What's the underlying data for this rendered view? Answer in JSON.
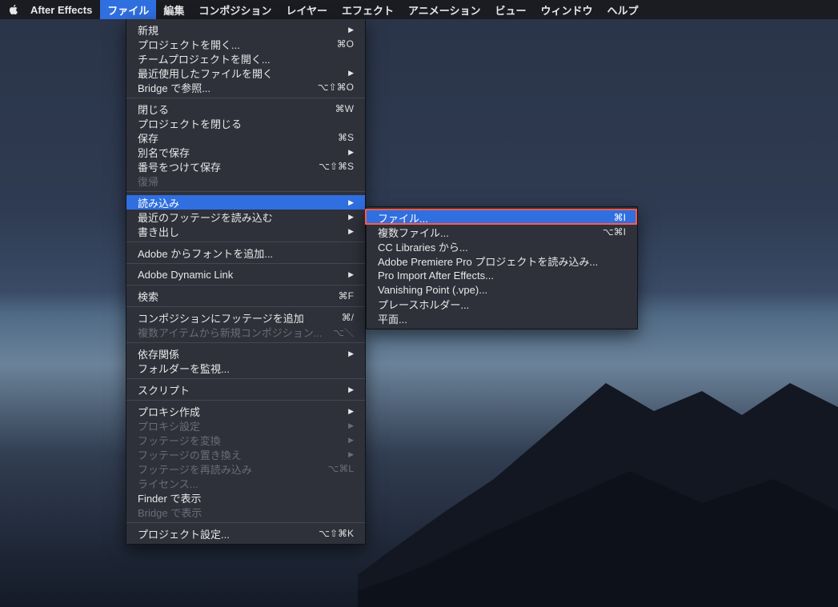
{
  "menubar": {
    "appname": "After Effects",
    "items": [
      "ファイル",
      "編集",
      "コンポジション",
      "レイヤー",
      "エフェクト",
      "アニメーション",
      "ビュー",
      "ウィンドウ",
      "ヘルプ"
    ],
    "selected_index": 0
  },
  "file_menu": {
    "groups": [
      [
        {
          "label": "新規",
          "submenu": true
        },
        {
          "label": "プロジェクトを開く...",
          "shortcut": "⌘O"
        },
        {
          "label": "チームプロジェクトを開く..."
        },
        {
          "label": "最近使用したファイルを開く",
          "submenu": true
        },
        {
          "label": "Bridge で参照...",
          "shortcut": "⌥⇧⌘O"
        }
      ],
      [
        {
          "label": "閉じる",
          "shortcut": "⌘W"
        },
        {
          "label": "プロジェクトを閉じる"
        },
        {
          "label": "保存",
          "shortcut": "⌘S"
        },
        {
          "label": "別名で保存",
          "submenu": true
        },
        {
          "label": "番号をつけて保存",
          "shortcut": "⌥⇧⌘S"
        },
        {
          "label": "復帰",
          "disabled": true
        }
      ],
      [
        {
          "label": "読み込み",
          "submenu": true,
          "selected": true
        },
        {
          "label": "最近のフッテージを読み込む",
          "submenu": true
        },
        {
          "label": "書き出し",
          "submenu": true
        }
      ],
      [
        {
          "label": "Adobe からフォントを追加..."
        }
      ],
      [
        {
          "label": "Adobe Dynamic Link",
          "submenu": true
        }
      ],
      [
        {
          "label": "検索",
          "shortcut": "⌘F"
        }
      ],
      [
        {
          "label": "コンポジションにフッテージを追加",
          "shortcut": "⌘/"
        },
        {
          "label": "複数アイテムから新規コンポジション...",
          "shortcut": "⌥＼",
          "disabled": true
        }
      ],
      [
        {
          "label": "依存関係",
          "submenu": true
        },
        {
          "label": "フォルダーを監視..."
        }
      ],
      [
        {
          "label": "スクリプト",
          "submenu": true
        }
      ],
      [
        {
          "label": "プロキシ作成",
          "submenu": true
        },
        {
          "label": "プロキシ設定",
          "submenu": true,
          "disabled": true
        },
        {
          "label": "フッテージを変換",
          "submenu": true,
          "disabled": true
        },
        {
          "label": "フッテージの置き換え",
          "submenu": true,
          "disabled": true
        },
        {
          "label": "フッテージを再読み込み",
          "shortcut": "⌥⌘L",
          "disabled": true
        },
        {
          "label": "ライセンス...",
          "disabled": true
        },
        {
          "label": "Finder で表示"
        },
        {
          "label": "Bridge で表示",
          "disabled": true
        }
      ],
      [
        {
          "label": "プロジェクト設定...",
          "shortcut": "⌥⇧⌘K"
        }
      ]
    ]
  },
  "import_submenu": {
    "items": [
      {
        "label": "ファイル...",
        "shortcut": "⌘I",
        "selected": true,
        "highlighted": true
      },
      {
        "label": "複数ファイル...",
        "shortcut": "⌥⌘I"
      },
      {
        "label": "CC Libraries から..."
      },
      {
        "label": "Adobe Premiere Pro プロジェクトを読み込み..."
      },
      {
        "label": "Pro Import After Effects..."
      },
      {
        "label": "Vanishing Point (.vpe)..."
      },
      {
        "label": "プレースホルダー..."
      },
      {
        "label": "平面..."
      }
    ]
  }
}
